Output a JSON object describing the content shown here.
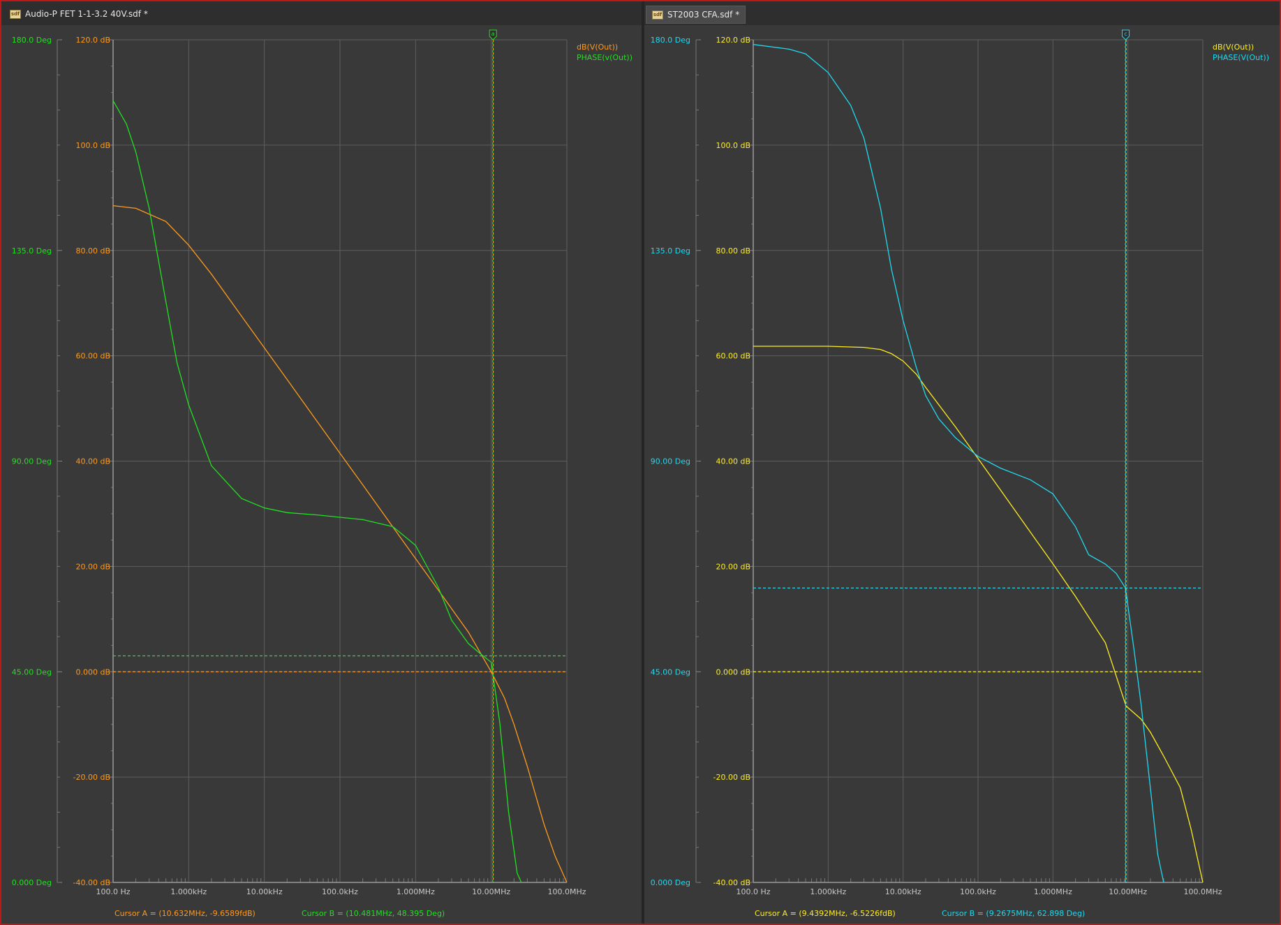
{
  "panes": [
    {
      "tab_title": "Audio-P FET 1-1-3.2 40V.sdf *",
      "tab_icon": "document-icon",
      "cursor_marker_label": "a",
      "legend": [
        "dB(V(Out))",
        "PHASE(v(Out))"
      ],
      "colors": {
        "mag": "#ff9a1e",
        "phase": "#22e022"
      },
      "cursor_a": "Cursor A = (10.632MHz, -9.6589fdB)",
      "cursor_b": "Cursor B = (10.481MHz, 48.395 Deg)"
    },
    {
      "tab_title": "ST2003 CFA.sdf *",
      "tab_icon": "document-icon",
      "cursor_marker_label": "c",
      "legend": [
        "dB(V(Out))",
        "PHASE(V(Out))"
      ],
      "colors": {
        "mag": "#ffee22",
        "phase": "#22d8ee"
      },
      "cursor_a": "Cursor A = (9.4392MHz, -6.5226fdB)",
      "cursor_b": "Cursor B = (9.2675MHz, 62.898 Deg)"
    }
  ],
  "chart_data": [
    {
      "type": "line",
      "x_scale": "log",
      "xlim": [
        100,
        100000000
      ],
      "ylim": [
        -40,
        120
      ],
      "y2lim": [
        0,
        180
      ],
      "grid": true,
      "legend_position": "top-right",
      "x_ticks": [
        "100.0 Hz",
        "1.000kHz",
        "10.00kHz",
        "100.0kHz",
        "1.000MHz",
        "10.00MHz",
        "100.0MHz"
      ],
      "y_ticks": [
        "120.0 dB",
        "100.0 dB",
        "80.00 dB",
        "60.00 dB",
        "40.00 dB",
        "20.00 dB",
        "0.000 dB",
        "-20.00 dB",
        "-40.00 dB"
      ],
      "y2_ticks": [
        "180.0 Deg",
        "135.0 Deg",
        "90.00 Deg",
        "45.00 Deg",
        "0.000 Deg"
      ],
      "series": [
        {
          "name": "dB(V(Out))",
          "axis": "dB",
          "x": [
            100,
            200,
            500,
            1000,
            2000,
            5000,
            10000,
            20000,
            50000,
            100000,
            200000,
            500000,
            1000000,
            2000000,
            5000000,
            10000000,
            15000000,
            20000000,
            30000000,
            50000000,
            70000000,
            100000000
          ],
          "y": [
            88.5,
            88,
            85.5,
            81,
            75.5,
            67.5,
            61.5,
            55.5,
            47.5,
            41.5,
            35.5,
            27.5,
            21.5,
            15.5,
            7.5,
            0,
            -5,
            -10,
            -18,
            -29,
            -35,
            -40
          ]
        },
        {
          "name": "PHASE(v(Out))",
          "axis": "Deg",
          "x": [
            100,
            150,
            200,
            300,
            500,
            700,
            1000,
            2000,
            5000,
            10000,
            20000,
            50000,
            100000,
            200000,
            500000,
            1000000,
            2000000,
            3000000,
            5000000,
            7000000,
            10000000,
            13000000,
            17000000,
            22000000,
            25000000
          ],
          "y": [
            167,
            162,
            156,
            144,
            124,
            111,
            102,
            89,
            82,
            80,
            79,
            78.5,
            78,
            77.5,
            76,
            72,
            63,
            56,
            51,
            49,
            47,
            34,
            15,
            2,
            0
          ]
        }
      ],
      "cursor_a_x": 10632000,
      "cursor_a_dB": -9.6589,
      "cursor_b_x": 10481000,
      "cursor_b_deg": 48.395
    },
    {
      "type": "line",
      "x_scale": "log",
      "xlim": [
        100,
        100000000
      ],
      "ylim": [
        -40,
        120
      ],
      "y2lim": [
        0,
        180
      ],
      "grid": true,
      "legend_position": "top-right",
      "x_ticks": [
        "100.0 Hz",
        "1.000kHz",
        "10.00kHz",
        "100.0kHz",
        "1.000MHz",
        "10.00MHz",
        "100.0MHz"
      ],
      "y_ticks": [
        "120.0 dB",
        "100.0 dB",
        "80.00 dB",
        "60.00 dB",
        "40.00 dB",
        "20.00 dB",
        "0.000 dB",
        "-20.00 dB",
        "-40.00 dB"
      ],
      "y2_ticks": [
        "180.0 Deg",
        "135.0 Deg",
        "90.00 Deg",
        "45.00 Deg",
        "0.000 Deg"
      ],
      "series": [
        {
          "name": "dB(V(Out))",
          "axis": "dB",
          "x": [
            100,
            1000,
            3000,
            5000,
            7000,
            10000,
            15000,
            20000,
            50000,
            100000,
            200000,
            500000,
            1000000,
            2000000,
            5000000,
            9439000,
            15000000,
            20000000,
            30000000,
            50000000,
            70000000,
            100000000
          ],
          "y": [
            61.8,
            61.8,
            61.6,
            61.2,
            60.4,
            59,
            56.5,
            54,
            46.5,
            40.5,
            34.5,
            26.5,
            20.5,
            14.3,
            5.5,
            -6.5,
            -9,
            -11.5,
            -16,
            -22,
            -30,
            -40
          ]
        },
        {
          "name": "PHASE(V(Out))",
          "axis": "Deg",
          "x": [
            100,
            300,
            500,
            1000,
            2000,
            3000,
            5000,
            7000,
            10000,
            15000,
            20000,
            30000,
            50000,
            100000,
            200000,
            500000,
            1000000,
            2000000,
            3000000,
            5000000,
            7000000,
            9268000,
            12000000,
            15000000,
            20000000,
            25000000,
            30000000
          ],
          "y": [
            179,
            178,
            177,
            173,
            166,
            159,
            144,
            131,
            120,
            110,
            104,
            99,
            95,
            91,
            88.5,
            86,
            83,
            76,
            70,
            68,
            66,
            62.9,
            50,
            38,
            20,
            6,
            0
          ]
        }
      ],
      "cursor_a_x": 9439200,
      "cursor_a_dB": -6.5226,
      "cursor_b_x": 9267500,
      "cursor_b_deg": 62.898
    }
  ]
}
